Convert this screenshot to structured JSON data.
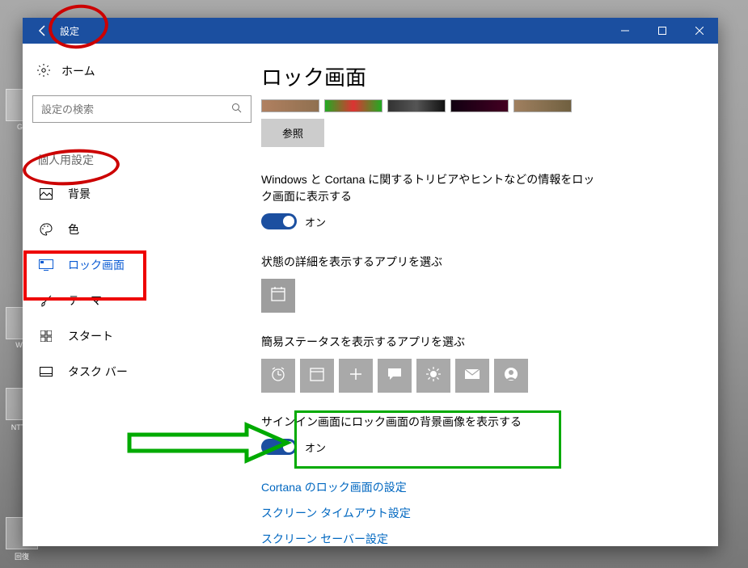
{
  "desktop": {
    "icons": [
      "Go",
      "Win",
      "NTT東",
      "回復"
    ]
  },
  "titlebar": {
    "title": "設定"
  },
  "sidebar": {
    "home": "ホーム",
    "search_placeholder": "設定の検索",
    "section_label": "個人用設定",
    "items": [
      {
        "icon": "picture",
        "label": "背景"
      },
      {
        "icon": "palette",
        "label": "色"
      },
      {
        "icon": "monitor",
        "label": "ロック画面"
      },
      {
        "icon": "brush",
        "label": "テーマ"
      },
      {
        "icon": "grid",
        "label": "スタート"
      },
      {
        "icon": "taskbar",
        "label": "タスク バー"
      }
    ]
  },
  "content": {
    "page_title": "ロック画面",
    "browse_label": "参照",
    "cortana_desc": "Windows と Cortana に関するトリビアやヒントなどの情報をロック画面に表示する",
    "toggle_on": "オン",
    "detailed_label": "状態の詳細を表示するアプリを選ぶ",
    "quick_label": "簡易ステータスを表示するアプリを選ぶ",
    "signin_bg_label": "サインイン画面にロック画面の背景画像を表示する",
    "link_cortana": "Cortana のロック画面の設定",
    "link_timeout": "スクリーン タイムアウト設定",
    "link_screensaver": "スクリーン セーバー設定"
  },
  "colors": {
    "accent": "#1b4fa0",
    "link": "#0067c0"
  }
}
